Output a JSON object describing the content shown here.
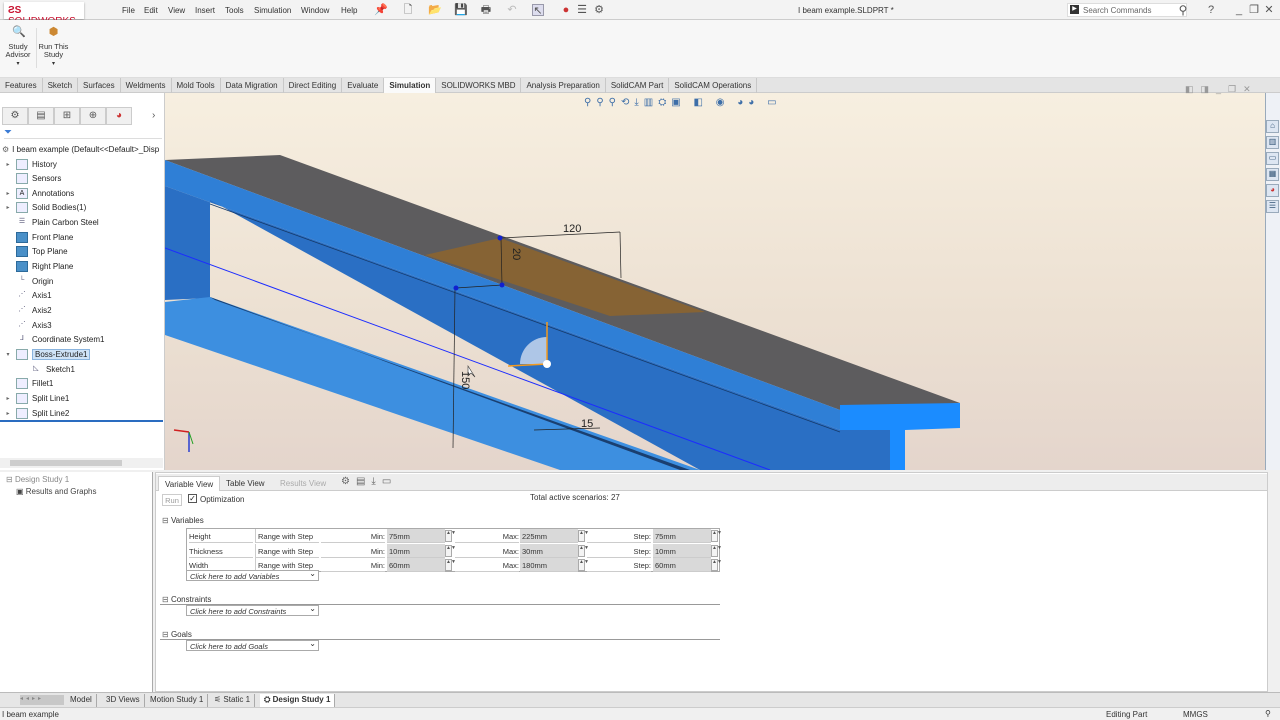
{
  "app": {
    "name": "SOLIDWORKS",
    "document_title": "I beam example.SLDPRT *"
  },
  "menu": [
    "File",
    "Edit",
    "View",
    "Insert",
    "Tools",
    "Simulation",
    "Window",
    "Help"
  ],
  "search": {
    "placeholder": "Search Commands"
  },
  "command_manager": {
    "study_advisor": "Study Advisor",
    "run_this_study": "Run This Study"
  },
  "tabs": [
    "Features",
    "Sketch",
    "Surfaces",
    "Weldments",
    "Mold Tools",
    "Data Migration",
    "Direct Editing",
    "Evaluate",
    "Simulation",
    "SOLIDWORKS MBD",
    "Analysis Preparation",
    "SolidCAM Part",
    "SolidCAM Operations"
  ],
  "active_tab": "Simulation",
  "feature_tree": {
    "root": "I beam example  (Default<<Default>_Disp",
    "items": [
      {
        "label": "History",
        "icon": "history-folder-icon",
        "expand": true
      },
      {
        "label": "Sensors",
        "icon": "sensors-folder-icon",
        "expand": false
      },
      {
        "label": "Annotations",
        "icon": "annotations-folder-icon",
        "expand": true
      },
      {
        "label": "Solid Bodies(1)",
        "icon": "solid-bodies-folder-icon",
        "expand": true
      },
      {
        "label": "Plain Carbon Steel",
        "icon": "material-icon",
        "expand": false
      },
      {
        "label": "Front Plane",
        "icon": "plane-icon",
        "expand": false
      },
      {
        "label": "Top Plane",
        "icon": "plane-icon",
        "expand": false
      },
      {
        "label": "Right Plane",
        "icon": "plane-icon",
        "expand": false
      },
      {
        "label": "Origin",
        "icon": "origin-icon",
        "expand": false
      },
      {
        "label": "Axis1",
        "icon": "axis-icon",
        "expand": false
      },
      {
        "label": "Axis2",
        "icon": "axis-icon",
        "expand": false
      },
      {
        "label": "Axis3",
        "icon": "axis-icon",
        "expand": false
      },
      {
        "label": "Coordinate System1",
        "icon": "coordinate-system-icon",
        "expand": false
      },
      {
        "label": "Boss-Extrude1",
        "icon": "extrude-icon",
        "expand": true,
        "selected": true
      },
      {
        "label": "Sketch1",
        "icon": "sketch-icon",
        "expand": false,
        "child": true
      },
      {
        "label": "Fillet1",
        "icon": "fillet-icon",
        "expand": false
      },
      {
        "label": "Split Line1",
        "icon": "split-line-icon",
        "expand": true
      },
      {
        "label": "Split Line2",
        "icon": "split-line-icon",
        "expand": true
      }
    ]
  },
  "viewport": {
    "dimensions": {
      "width": "120",
      "flange": "20",
      "height": "150",
      "web": "15"
    }
  },
  "study_tree": {
    "root": "Design Study 1",
    "child": "Results and Graphs"
  },
  "design_study": {
    "view_tabs": [
      "Variable View",
      "Table View",
      "Results View"
    ],
    "run_label": "Run",
    "optimization_label": "Optimization",
    "optimization_checked": true,
    "total_label": "Total active scenarios:",
    "total_value": "27",
    "variables_title": "Variables",
    "min_label": "Min:",
    "max_label": "Max:",
    "step_label": "Step:",
    "variables": [
      {
        "name": "Height",
        "type": "Range with Step",
        "min": "75mm",
        "max": "225mm",
        "step": "75mm"
      },
      {
        "name": "Thickness",
        "type": "Range with Step",
        "min": "10mm",
        "max": "30mm",
        "step": "10mm"
      },
      {
        "name": "Width",
        "type": "Range with Step",
        "min": "60mm",
        "max": "180mm",
        "step": "60mm"
      }
    ],
    "add_variables": "Click here to add Variables",
    "constraints_title": "Constraints",
    "add_constraints": "Click here to add Constraints",
    "goals_title": "Goals",
    "add_goals": "Click here to add Goals"
  },
  "model_tabs": [
    "Model",
    "3D Views",
    "Motion Study 1",
    "Static 1",
    "Design Study 1"
  ],
  "status": {
    "left": "I beam example",
    "mode": "Editing Part",
    "units": "MMGS"
  }
}
